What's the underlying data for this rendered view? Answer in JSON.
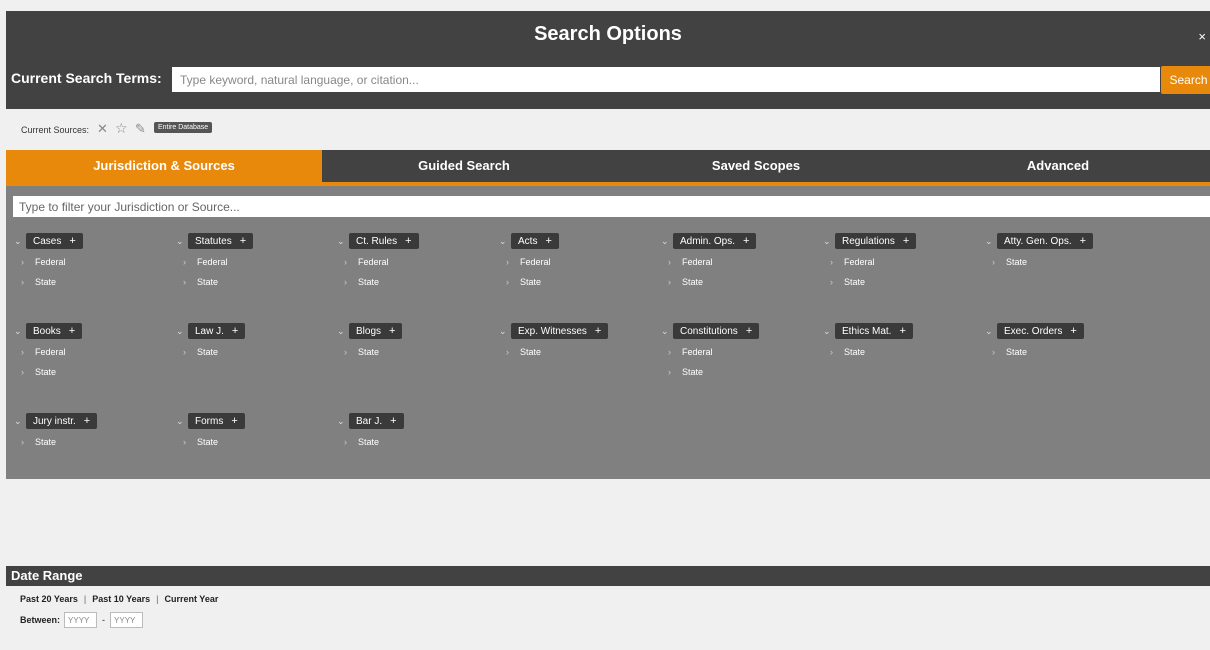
{
  "header": {
    "title": "Search Options",
    "close": "×",
    "terms_label": "Current Search Terms:",
    "search_placeholder": "Type keyword, natural language, or citation...",
    "search_button": "Search"
  },
  "sources": {
    "label": "Current Sources:",
    "icons": [
      "close-icon",
      "star-icon",
      "pencil-icon"
    ],
    "badge": "Entire Database"
  },
  "tabs": [
    "Jurisdiction & Sources",
    "Guided Search",
    "Saved Scopes",
    "Advanced"
  ],
  "filter_placeholder": "Type to filter your Jurisdiction or Source...",
  "groups": [
    {
      "label": "Cases",
      "subs": [
        "Federal",
        "State"
      ]
    },
    {
      "label": "Statutes",
      "subs": [
        "Federal",
        "State"
      ]
    },
    {
      "label": "Ct. Rules",
      "subs": [
        "Federal",
        "State"
      ]
    },
    {
      "label": "Acts",
      "subs": [
        "Federal",
        "State"
      ]
    },
    {
      "label": "Admin. Ops.",
      "subs": [
        "Federal",
        "State"
      ]
    },
    {
      "label": "Regulations",
      "subs": [
        "Federal",
        "State"
      ]
    },
    {
      "label": "Atty. Gen. Ops.",
      "subs": [
        "State"
      ]
    },
    {
      "label": "Books",
      "subs": [
        "Federal",
        "State"
      ]
    },
    {
      "label": "Law J.",
      "subs": [
        "State"
      ]
    },
    {
      "label": "Blogs",
      "subs": [
        "State"
      ]
    },
    {
      "label": "Exp. Witnesses",
      "subs": [
        "State"
      ]
    },
    {
      "label": "Constitutions",
      "subs": [
        "Federal",
        "State"
      ]
    },
    {
      "label": "Ethics Mat.",
      "subs": [
        "State"
      ]
    },
    {
      "label": "Exec. Orders",
      "subs": [
        "State"
      ]
    },
    {
      "label": "Jury instr.",
      "subs": [
        "State"
      ]
    },
    {
      "label": "Forms",
      "subs": [
        "State"
      ]
    },
    {
      "label": "Bar J.",
      "subs": [
        "State"
      ]
    }
  ],
  "date_range": {
    "title": "Date Range",
    "links": [
      "Past 20 Years",
      "Past 10 Years",
      "Current Year"
    ],
    "separator": "|",
    "between_label": "Between:",
    "from_placeholder": "YYYY",
    "dash": "-",
    "to_placeholder": "YYYY"
  },
  "colors": {
    "accent": "#e8890c",
    "header": "#424242",
    "panel": "#808080"
  }
}
